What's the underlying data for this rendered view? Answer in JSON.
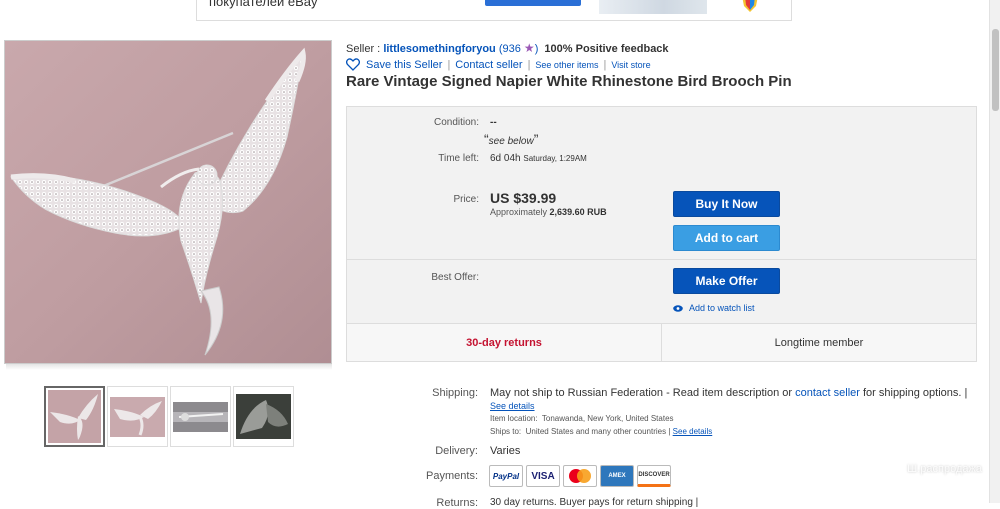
{
  "banner": {
    "text": "покупателей eBay",
    "button_label": ""
  },
  "seller": {
    "prefix": "Seller :",
    "name": "littlesomethingforyou",
    "feedback_count": "(936",
    "feedback_pct": "100% Positive feedback",
    "save_label": "Save this Seller",
    "contact_label": "Contact seller",
    "other_items": "See other items",
    "visit_store": "Visit store"
  },
  "title": "Rare Vintage Signed Napier White Rhinestone Bird Brooch Pin",
  "buybox": {
    "condition_label": "Condition:",
    "condition_value": "--",
    "condition_note": "see below",
    "time_label": "Time left:",
    "time_value": "6d 04h",
    "time_detail": "Saturday, 1:29AM",
    "price_label": "Price:",
    "price_value": "US $39.99",
    "approx_prefix": "Approximately",
    "approx_value": "2,639.60 RUB",
    "buy_now": "Buy It Now",
    "add_cart": "Add to cart",
    "best_offer_label": "Best Offer:",
    "make_offer": "Make Offer",
    "watch_label": "Add to watch list",
    "returns_badge": "30-day returns",
    "member_badge": "Longtime member"
  },
  "shipping": {
    "label": "Shipping:",
    "text_prefix": "May not ship to Russian Federation - Read item description or",
    "contact_link": "contact seller",
    "text_suffix": "for shipping options. |",
    "see_details": "See details",
    "location_label": "Item location:",
    "location": "Tonawanda, New York, United States",
    "ships_to_label": "Ships to:",
    "ships_to": "United States and many other countries |",
    "ships_to_link": "See details"
  },
  "delivery": {
    "label": "Delivery:",
    "value": "Varies"
  },
  "payments": {
    "label": "Payments:",
    "cards": [
      "PayPal",
      "VISA",
      "MasterCard",
      "AMEX",
      "DISCOVER"
    ]
  },
  "returns": {
    "label": "Returns:",
    "value": "30 day returns. Buyer pays for return shipping |"
  },
  "watermark": "Ш.распродажа",
  "colors": {
    "link": "#0654ba",
    "buy_button": "#0654ba",
    "cart_button": "#3a9ee3",
    "returns_red": "#c41230"
  }
}
